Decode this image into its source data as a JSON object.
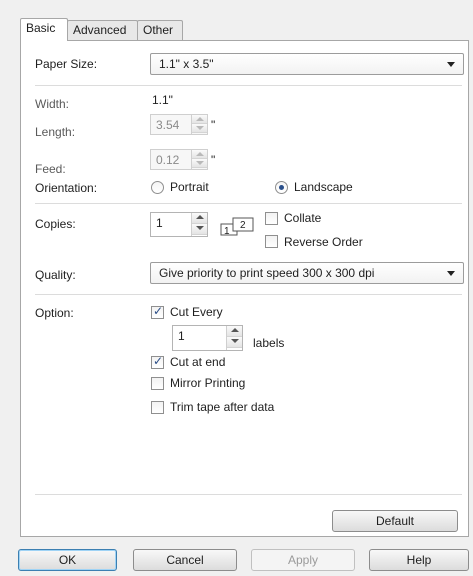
{
  "tabs": [
    {
      "label": "Basic"
    },
    {
      "label": "Advanced"
    },
    {
      "label": "Other"
    }
  ],
  "basic": {
    "paper_size": {
      "label": "Paper Size:",
      "value": "1.1\" x 3.5\""
    },
    "width": {
      "label": "Width:",
      "value": "1.1\""
    },
    "length": {
      "label": "Length:",
      "value": "3.54",
      "unit": "\""
    },
    "feed": {
      "label": "Feed:",
      "value": "0.12",
      "unit": "\""
    },
    "orientation": {
      "label": "Orientation:",
      "portrait": "Portrait",
      "landscape": "Landscape",
      "selected": "landscape"
    },
    "copies": {
      "label": "Copies:",
      "value": "1",
      "collate": "Collate",
      "reverse_order": "Reverse Order",
      "icon_page1": "1",
      "icon_page2": "2"
    },
    "quality": {
      "label": "Quality:",
      "value": "Give priority to print speed 300 x 300 dpi"
    },
    "option": {
      "label": "Option:",
      "cut_every": "Cut Every",
      "cut_every_value": "1",
      "labels_unit": "labels",
      "cut_at_end": "Cut at end",
      "mirror_printing": "Mirror Printing",
      "trim_tape": "Trim tape after data"
    },
    "default_button": "Default"
  },
  "footer": {
    "ok": "OK",
    "cancel": "Cancel",
    "apply": "Apply",
    "help": "Help"
  },
  "colors": {
    "panel_bg": "#ffffff",
    "dialog_bg": "#f0f0f0",
    "default_button_border": "#3c7fb1"
  }
}
